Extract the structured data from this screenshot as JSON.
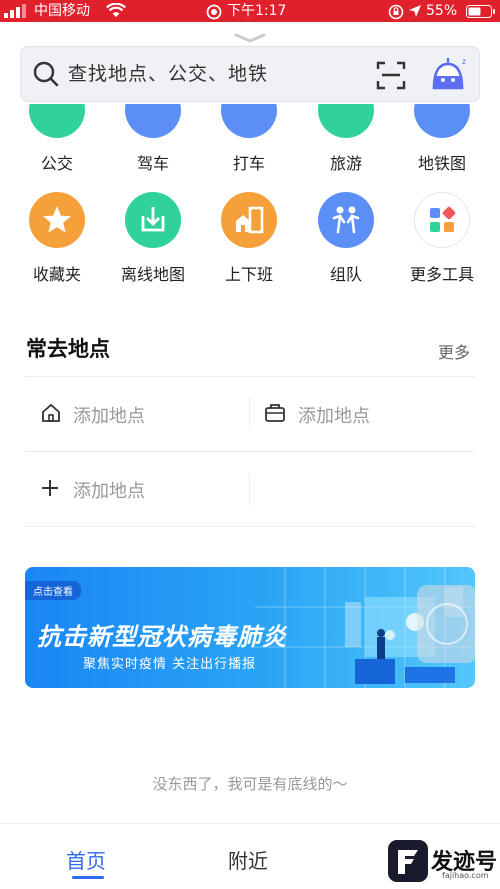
{
  "status_bar": {
    "carrier": "中国移动",
    "time": "下午1:17",
    "battery": "55%"
  },
  "search": {
    "placeholder": "查找地点、公交、地铁"
  },
  "shortcuts_row1": [
    {
      "label": "公交",
      "color": "#2fd39a"
    },
    {
      "label": "驾车",
      "color": "#5b8ff6"
    },
    {
      "label": "打车",
      "color": "#5b8ff6"
    },
    {
      "label": "旅游",
      "color": "#2fd39a"
    },
    {
      "label": "地铁图",
      "color": "#5b8ff6"
    }
  ],
  "shortcuts_row2": [
    {
      "label": "收藏夹",
      "icon": "star-icon",
      "color": "#f5a03a"
    },
    {
      "label": "离线地图",
      "icon": "download-icon",
      "color": "#2fd39a"
    },
    {
      "label": "上下班",
      "icon": "home-office-icon",
      "color": "#f5a03a"
    },
    {
      "label": "组队",
      "icon": "team-icon",
      "color": "#5b8ff6"
    },
    {
      "label": "更多工具",
      "icon": "apps-grid-icon",
      "color": "#ffffff"
    }
  ],
  "frequent_places": {
    "title": "常去地点",
    "more": "更多",
    "home_label": "添加地点",
    "work_label": "添加地点",
    "add_label": "添加地点"
  },
  "banner": {
    "tag": "点击查看",
    "title": "抗击新型冠状病毒肺炎",
    "subtitle": "聚焦实时疫情 关注出行播报"
  },
  "footer_note": "没东西了，我可是有底线的～",
  "tabs": [
    {
      "label": "首页",
      "active": true
    },
    {
      "label": "附近",
      "active": false
    }
  ],
  "watermark": {
    "text": "发迹号",
    "url": "fajihao.com"
  }
}
